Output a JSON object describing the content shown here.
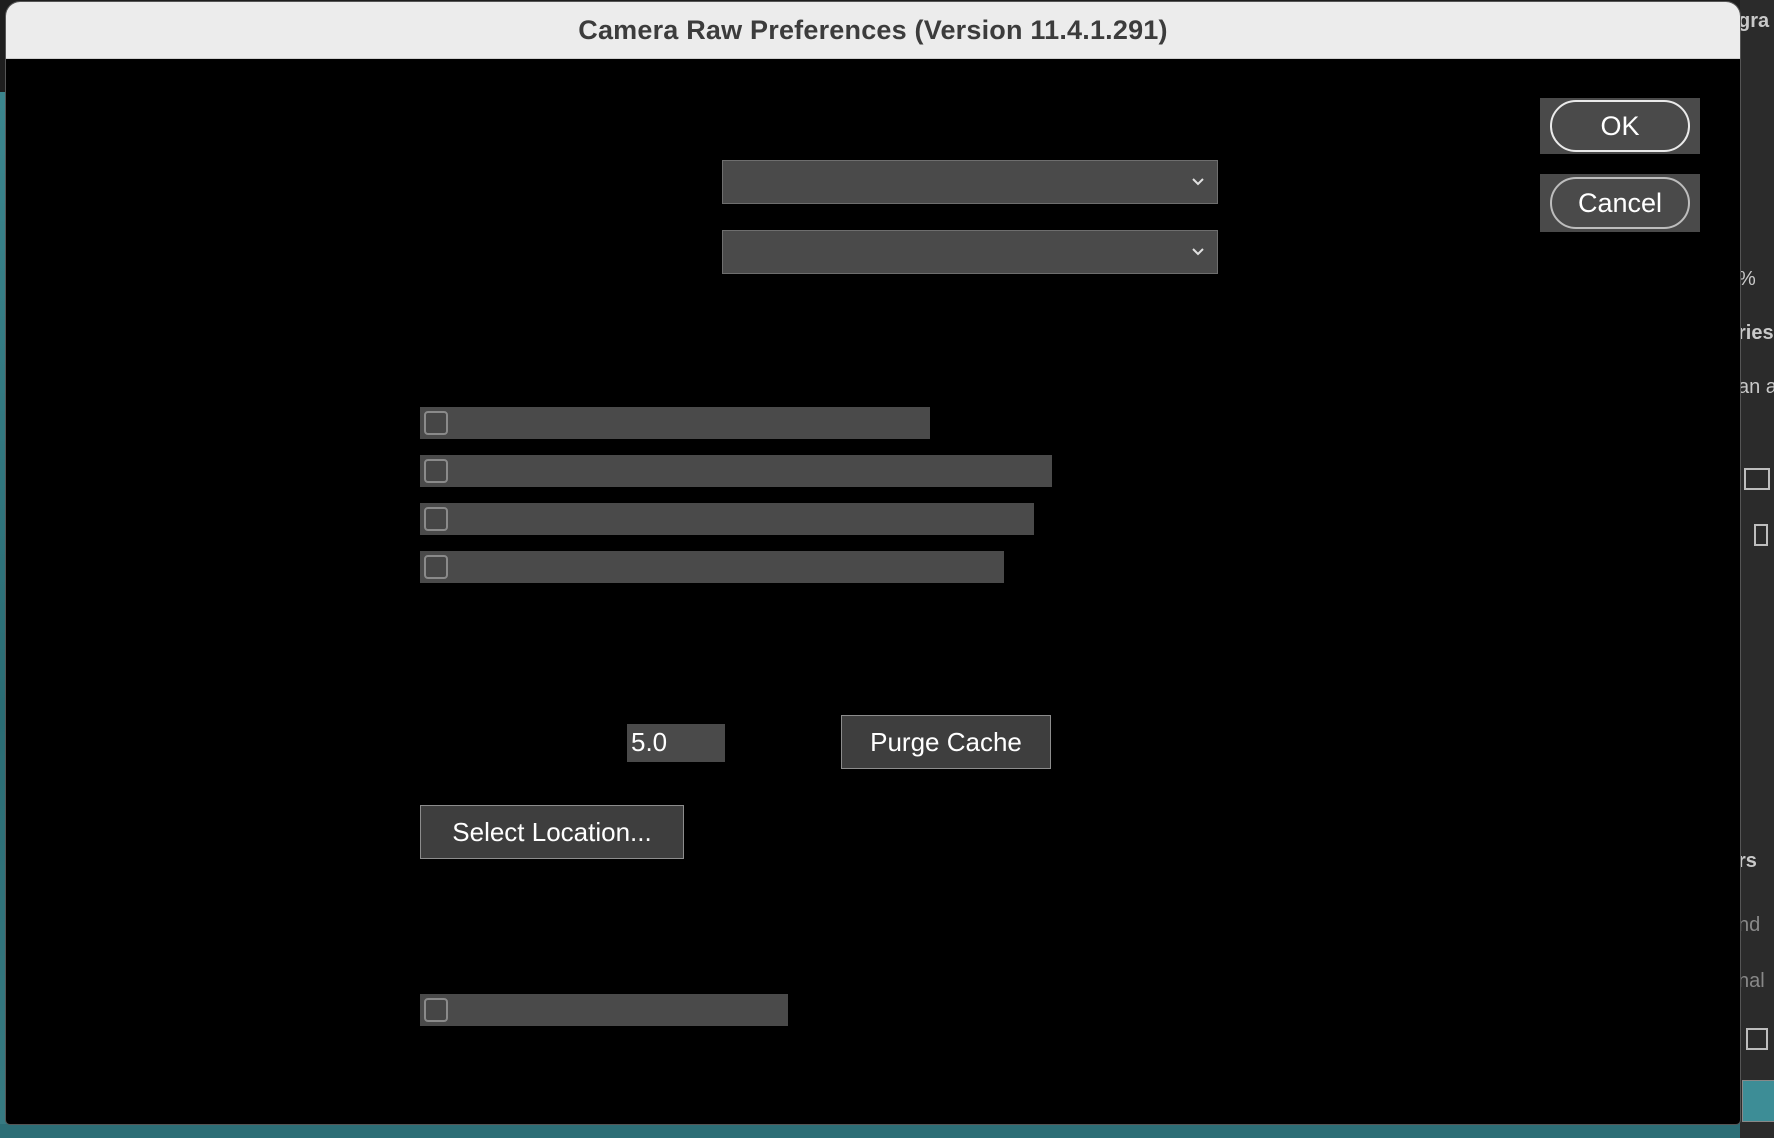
{
  "dialog": {
    "title": "Camera Raw Preferences  (Version 11.4.1.291)",
    "ok_label": "OK",
    "cancel_label": "Cancel"
  },
  "dropdowns": [
    {
      "value": ""
    },
    {
      "value": ""
    }
  ],
  "checkboxes": [
    {
      "label": "",
      "checked": false
    },
    {
      "label": "",
      "checked": false
    },
    {
      "label": "",
      "checked": false
    },
    {
      "label": "",
      "checked": false
    },
    {
      "label": "",
      "checked": false
    }
  ],
  "cache": {
    "size_value": "5.0",
    "purge_label": "Purge Cache",
    "select_location_label": "Select Location..."
  },
  "background": {
    "fragments": [
      "gra",
      "%",
      "ries",
      "an ac",
      "rs",
      "nd",
      "nal"
    ]
  },
  "colors": {
    "dialog_bg": "#000000",
    "control_bg": "#4a4a4a",
    "titlebar_bg": "#ececec"
  }
}
